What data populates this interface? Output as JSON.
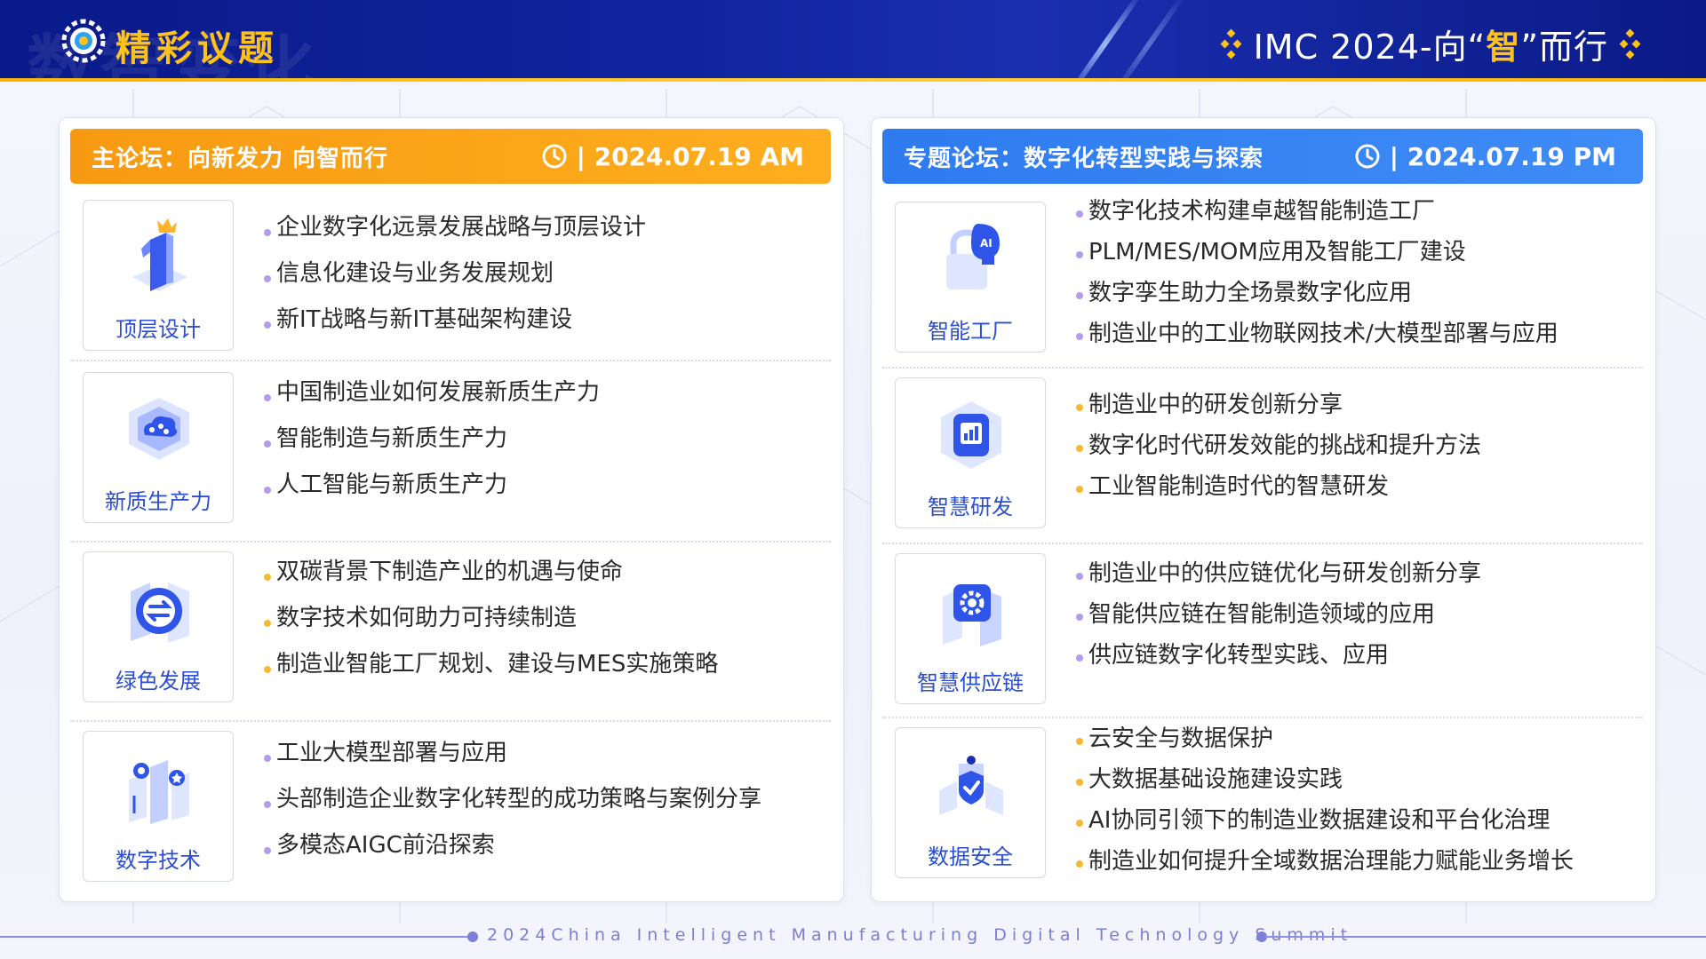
{
  "header": {
    "ghost_title": "数智变化",
    "title": "精彩议题",
    "event_prefix": "IMC 2024-向“",
    "event_highlight": "智",
    "event_suffix": "”而行",
    "colors": {
      "bar": "#10249e",
      "accent": "#ffc21a"
    }
  },
  "left_panel": {
    "title": "主论坛：向新发力  向智而行",
    "time": "| 2024.07.19  AM",
    "color": "#f79a12",
    "sections": [
      {
        "label": "顶层设计",
        "icon": "crown-number-one-icon",
        "items": [
          "企业数字化远景发展战略与顶层设计",
          "信息化建设与业务发展规划",
          "新IT战略与新IT基础架构建设"
        ]
      },
      {
        "label": "新质生产力",
        "icon": "cloud-cube-icon",
        "items": [
          "中国制造业如何发展新质生产力",
          "智能制造与新质生产力",
          "人工智能与新质生产力"
        ]
      },
      {
        "label": "绿色发展",
        "icon": "exchange-cube-icon",
        "items": [
          "双碳背景下制造产业的机遇与使命",
          "数字技术如何助力可持续制造",
          "制造业智能工厂规划、建设与MES实施策略"
        ]
      },
      {
        "label": "数字技术",
        "icon": "digital-blocks-icon",
        "items": [
          "工业大模型部署与应用",
          "头部制造企业数字化转型的成功策略与案例分享",
          "多模态AIGC前沿探索"
        ]
      }
    ]
  },
  "right_panel": {
    "title": "专题论坛：数字化转型实践与探索",
    "time": "| 2024.07.19  PM",
    "color": "#2e7bf0",
    "sections": [
      {
        "label": "智能工厂",
        "icon": "ai-head-lock-icon",
        "items": [
          "数字化技术构建卓越智能制造工厂",
          "PLM/MES/MOM应用及智能工厂建设",
          "数字孪生助力全场景数字化应用",
          "制造业中的工业物联网技术/大模型部署与应用"
        ]
      },
      {
        "label": "智慧研发",
        "icon": "chart-device-icon",
        "items": [
          "制造业中的研发创新分享",
          "数字化时代研发效能的挑战和提升方法",
          "工业智能制造时代的智慧研发"
        ]
      },
      {
        "label": "智慧供应链",
        "icon": "gear-cube-icon",
        "items": [
          "制造业中的供应链优化与研发创新分享",
          "智能供应链在智能制造领域的应用",
          "供应链数字化转型实践、应用"
        ]
      },
      {
        "label": "数据安全",
        "icon": "shield-check-cubes-icon",
        "items": [
          "云安全与数据保护",
          "大数据基础设施建设实践",
          "AI协同引领下的制造业数据建设和平台化治理",
          "制造业如何提升全域数据治理能力赋能业务增长"
        ]
      }
    ]
  },
  "footer": {
    "text": "2024China Intelligent Manufacturing Digital Technology Summit"
  }
}
